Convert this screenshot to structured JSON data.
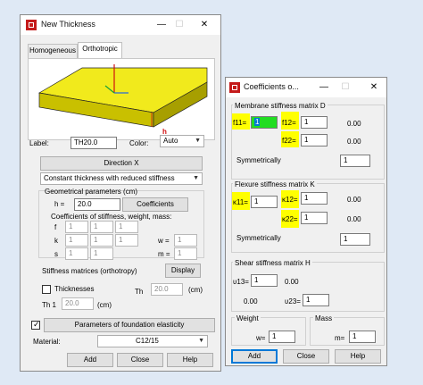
{
  "win1": {
    "title": "New Thickness",
    "tabs": [
      "Homogeneous",
      "Orthotropic"
    ],
    "axis_h": "h",
    "label_caption": "Label:",
    "label_value": "TH20.0",
    "color_caption": "Color:",
    "color_value": "Auto",
    "direction_button": "Direction X",
    "thickness_mode": "Constant thickness with reduced stiffness",
    "geom_title": "Geometrical parameters (cm)",
    "h_caption": "h  =",
    "h_value": "20.0",
    "coefficients_button": "Coefficients",
    "coef_title": "Coefficients of stiffness, weight, mass:",
    "f_caption": "f",
    "k_caption": "k",
    "s_caption": "s",
    "f_values": [
      "1",
      "1",
      "1"
    ],
    "k_values": [
      "1",
      "1",
      "1"
    ],
    "s_values": [
      "1",
      "1",
      "1"
    ],
    "w_caption": "w =",
    "w_value": "1",
    "m_caption": "m =",
    "m_value": "1",
    "stiff_title": "Stiffness matrices (orthotropy)",
    "display_button": "Display",
    "thicknesses_caption": "Thicknesses",
    "th_caption": "Th",
    "th_value": "20.0",
    "th_unit": "(cm)",
    "th1_caption": "Th 1",
    "th1_value": "20.0",
    "th1_unit": "(cm)",
    "foundation_button": "Parameters of foundation elasticity",
    "material_caption": "Material:",
    "material_value": "C12/15",
    "add_button": "Add",
    "close_button": "Close",
    "help_button": "Help"
  },
  "win2": {
    "title": "Coefficients o...",
    "membrane_title": "Membrane stiffness matrix D",
    "f11_caption": "f11=",
    "f11_value": "1",
    "f12_caption": "f12=",
    "f12_value": "1",
    "d13_value": "0.00",
    "f22_caption": "f22=",
    "f22_value": "1",
    "d23_value": "0.00",
    "sym_caption_1": "Symmetrically",
    "f33_value": "1",
    "flexure_title": "Flexure stiffness matrix K",
    "k11_caption": "κ11=",
    "k11_value": "1",
    "k12_caption": "κ12=",
    "k12_value": "1",
    "k13_value": "0.00",
    "k22_caption": "κ22=",
    "k22_value": "1",
    "k23_value": "0.00",
    "sym_caption_2": "Symmetrically",
    "k33_value": "1",
    "shear_title": "Shear stiffness matrix H",
    "s13_caption": "υ13=",
    "s13_value": "1",
    "h12_value": "0.00",
    "h21_value": "0.00",
    "s23_caption": "υ23=",
    "s23_value": "1",
    "weight_title": "Weight",
    "w_caption": "w=",
    "w_value": "1",
    "mass_title": "Mass",
    "m_caption": "m=",
    "m_value": "1",
    "add_button": "Add",
    "close_button": "Close",
    "help_button": "Help"
  },
  "colors": {
    "highlight": "#ffff00",
    "selection": "#22dd22",
    "accent": "#0078d7",
    "slab_top": "#f1ea1c",
    "slab_side": "#c9c000"
  }
}
